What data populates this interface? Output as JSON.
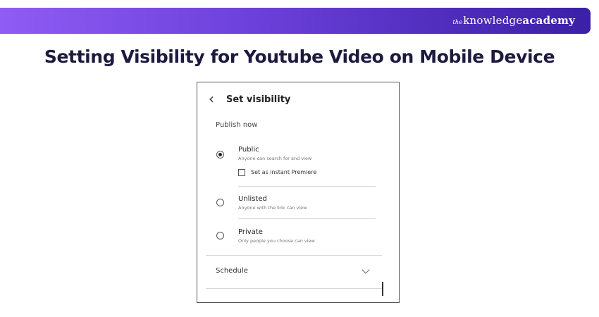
{
  "banner": {
    "brand_the": "the",
    "brand_knowledge": "knowledge",
    "brand_academy": "academy"
  },
  "page": {
    "title": "Setting Visibility for Youtube Video on Mobile Device"
  },
  "screen": {
    "back_icon": "chevron-left-icon",
    "title": "Set visibility",
    "section_label": "Publish now",
    "options": [
      {
        "label": "Public",
        "description": "Anyone can search for and view",
        "selected": true
      },
      {
        "label": "Unlisted",
        "description": "Anyone with the link can view",
        "selected": false
      },
      {
        "label": "Private",
        "description": "Only people you choose can view",
        "selected": false
      }
    ],
    "premiere_checkbox": {
      "label": "Set as instant Premiere",
      "checked": false
    },
    "schedule": {
      "label": "Schedule",
      "icon": "chevron-down-icon"
    }
  }
}
